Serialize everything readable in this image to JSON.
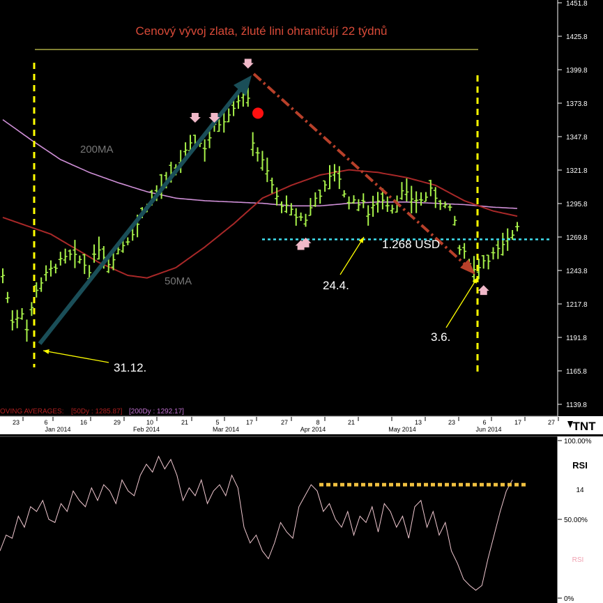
{
  "title": "Cenový vývoj zlata, žluté lini ohraničují 22 týdnů",
  "legend_text": "OVING AVERAGES:",
  "legend_50": "[50Dy : 1285.87]",
  "legend_200": "[200Dy : 1292.17]",
  "logo_text": "TNT",
  "colors": {
    "background": "#000000",
    "price_bars": "#a8f24a",
    "ma50": "#a82828",
    "ma200": "#d090d8",
    "rsi": "#f0c8d0",
    "title": "#d84a38",
    "axis_text": "#ffffff",
    "annotation": "#ffff00",
    "support": "#40e0f0",
    "trend_up": "#1a4e58",
    "trend_down": "#b8402a",
    "rsi_line": "#f0c040"
  },
  "annotations": {
    "ma200_label": "200MA",
    "ma50_label": "50MA",
    "support_label": "1.268 USD",
    "date_label_1": "31.12.",
    "date_label_2": "24.4.",
    "date_label_3": "3.6."
  },
  "rsi_panel": {
    "label": "RSI",
    "period": "14",
    "sub_label": "RSI",
    "ticks": [
      "100.00%",
      "50.00%",
      "0%"
    ]
  },
  "chart_data": [
    {
      "type": "bar",
      "subtype": "ohlc",
      "title": "Cenový vývoj zlata, žluté lini ohraničují 22 týdnů",
      "y_ticks": [
        1451.8,
        1425.8,
        1399.8,
        1373.8,
        1347.8,
        1321.8,
        1295.8,
        1269.8,
        1243.8,
        1217.8,
        1191.8,
        1165.8,
        1139.8
      ],
      "ylim": [
        1139.8,
        1451.8
      ],
      "x_day_ticks": [
        "23",
        "6",
        "16",
        "29",
        "10",
        "21",
        "5",
        "17",
        "27",
        "8",
        "21",
        "",
        "13",
        "23",
        "6",
        "17",
        "27"
      ],
      "x_month_ticks": [
        "Jan 2014",
        "Feb 2014",
        "Mar 2014",
        "Apr 2014",
        "May 2014",
        "Jun 2014"
      ],
      "price_keypoints": [
        [
          0,
          1240
        ],
        [
          2,
          1205
        ],
        [
          4,
          1212
        ],
        [
          5,
          1198
        ],
        [
          7,
          1230
        ],
        [
          9,
          1240
        ],
        [
          11,
          1248
        ],
        [
          14,
          1255
        ],
        [
          16,
          1252
        ],
        [
          18,
          1245
        ],
        [
          20,
          1262
        ],
        [
          22,
          1250
        ],
        [
          24,
          1260
        ],
        [
          26,
          1268
        ],
        [
          28,
          1280
        ],
        [
          30,
          1295
        ],
        [
          32,
          1305
        ],
        [
          34,
          1312
        ],
        [
          36,
          1322
        ],
        [
          38,
          1335
        ],
        [
          40,
          1345
        ],
        [
          42,
          1340
        ],
        [
          44,
          1355
        ],
        [
          46,
          1362
        ],
        [
          48,
          1372
        ],
        [
          50,
          1382
        ],
        [
          51,
          1375
        ],
        [
          52,
          1345
        ],
        [
          53,
          1336
        ],
        [
          55,
          1320
        ],
        [
          57,
          1300
        ],
        [
          59,
          1292
        ],
        [
          61,
          1286
        ],
        [
          63,
          1284
        ],
        [
          65,
          1300
        ],
        [
          67,
          1308
        ],
        [
          69,
          1322
        ],
        [
          70,
          1316
        ],
        [
          71,
          1302
        ],
        [
          73,
          1296
        ],
        [
          75,
          1298
        ],
        [
          76,
          1285
        ],
        [
          77,
          1296
        ],
        [
          79,
          1300
        ],
        [
          81,
          1293
        ],
        [
          83,
          1304
        ],
        [
          85,
          1300
        ],
        [
          87,
          1298
        ],
        [
          89,
          1305
        ],
        [
          91,
          1298
        ],
        [
          93,
          1290
        ],
        [
          94,
          1282
        ],
        [
          95,
          1260
        ],
        [
          97,
          1252
        ],
        [
          98,
          1244
        ],
        [
          100,
          1252
        ],
        [
          102,
          1256
        ],
        [
          104,
          1262
        ],
        [
          106,
          1272
        ],
        [
          107,
          1280
        ]
      ],
      "ma50": [
        [
          0,
          1285
        ],
        [
          10,
          1272
        ],
        [
          20,
          1250
        ],
        [
          26,
          1240
        ],
        [
          30,
          1238
        ],
        [
          36,
          1246
        ],
        [
          42,
          1262
        ],
        [
          48,
          1280
        ],
        [
          54,
          1300
        ],
        [
          60,
          1310
        ],
        [
          66,
          1318
        ],
        [
          72,
          1322
        ],
        [
          78,
          1320
        ],
        [
          84,
          1316
        ],
        [
          90,
          1310
        ],
        [
          96,
          1298
        ],
        [
          102,
          1290
        ],
        [
          107,
          1286
        ]
      ],
      "ma200": [
        [
          0,
          1361
        ],
        [
          6,
          1345
        ],
        [
          12,
          1330
        ],
        [
          18,
          1320
        ],
        [
          24,
          1312
        ],
        [
          30,
          1305
        ],
        [
          36,
          1300
        ],
        [
          42,
          1298
        ],
        [
          48,
          1297
        ],
        [
          54,
          1296
        ],
        [
          60,
          1294
        ],
        [
          66,
          1294
        ],
        [
          72,
          1296
        ],
        [
          78,
          1297
        ],
        [
          84,
          1297
        ],
        [
          90,
          1296
        ],
        [
          96,
          1295
        ],
        [
          102,
          1293
        ],
        [
          107,
          1292
        ]
      ],
      "support_level": 1268,
      "markers_down": [
        [
          40,
          1363
        ],
        [
          44,
          1363
        ],
        [
          51,
          1405
        ]
      ],
      "markers_up": [
        [
          62,
          1263
        ],
        [
          63,
          1265
        ],
        [
          100,
          1228
        ]
      ],
      "high_point": [
        52,
        1366
      ]
    },
    {
      "type": "line",
      "title": "RSI",
      "ylim": [
        0,
        100
      ],
      "y_ticks": [
        "100.00%",
        "50.00%",
        "0%"
      ],
      "values": [
        30,
        40,
        38,
        52,
        45,
        58,
        55,
        62,
        50,
        48,
        60,
        55,
        68,
        62,
        58,
        70,
        62,
        72,
        68,
        60,
        75,
        68,
        65,
        78,
        85,
        80,
        90,
        82,
        88,
        78,
        62,
        70,
        65,
        75,
        60,
        68,
        72,
        65,
        78,
        70,
        45,
        35,
        40,
        30,
        25,
        35,
        48,
        42,
        38,
        58,
        65,
        72,
        68,
        55,
        60,
        50,
        45,
        55,
        40,
        52,
        48,
        58,
        42,
        60,
        55,
        45,
        52,
        38,
        58,
        62,
        45,
        55,
        40,
        48,
        30,
        22,
        12,
        8,
        5,
        8,
        25,
        40,
        55,
        68,
        75
      ],
      "resistance": 72
    }
  ]
}
